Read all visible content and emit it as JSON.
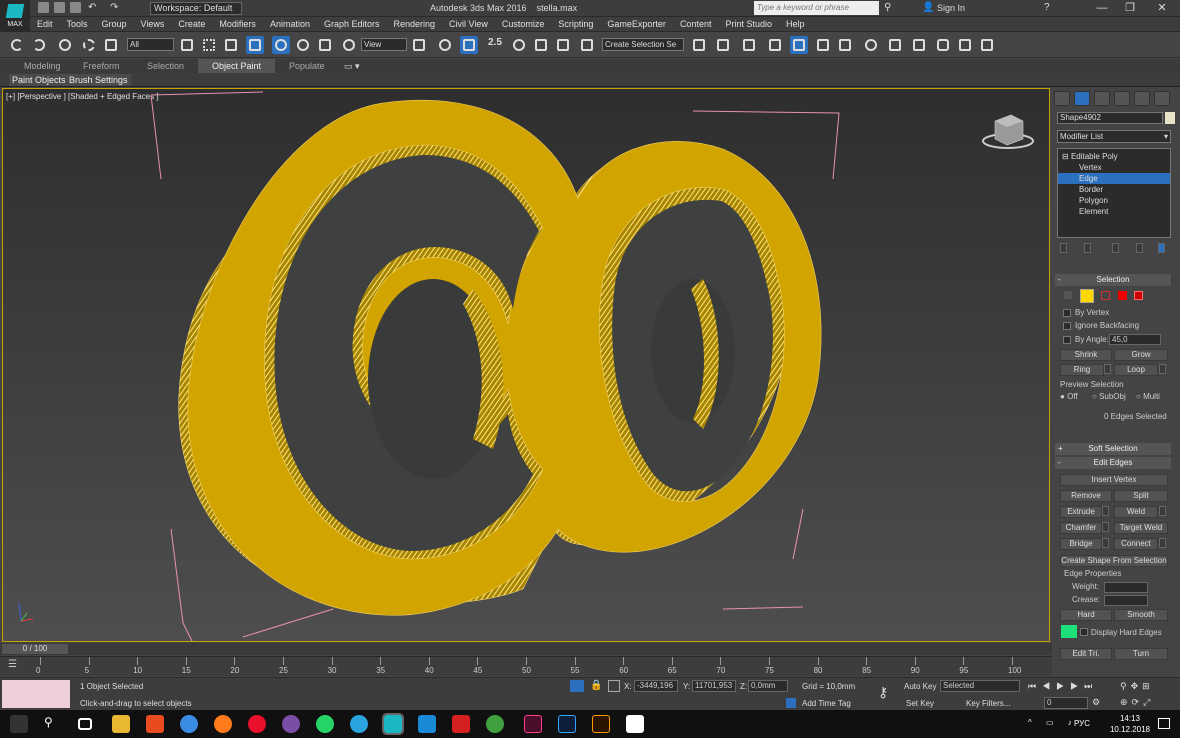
{
  "app": {
    "logo_text": "MAX",
    "title": "Autodesk 3ds Max 2016",
    "file": "stella.max",
    "workspace": "Workspace: Default",
    "search_placeholder": "Type a keyword or phrase",
    "sign_in": "Sign In"
  },
  "menu": [
    "Edit",
    "Tools",
    "Group",
    "Views",
    "Create",
    "Modifiers",
    "Animation",
    "Graph Editors",
    "Rendering",
    "Civil View",
    "Customize",
    "Scripting",
    "GameExporter",
    "Content",
    "Print Studio",
    "Help"
  ],
  "toolbar": {
    "filter_value": "All",
    "refcoord_value": "View",
    "selection_set_placeholder": "Create Selection Se",
    "snap_label": "2.5"
  },
  "ribbon": {
    "tabs": [
      "Modeling",
      "Freeform",
      "Selection",
      "Object Paint",
      "Populate"
    ],
    "active_tab": "Object Paint",
    "sub": [
      "Paint Objects",
      "Brush Settings"
    ]
  },
  "viewport": {
    "label": "[+] [Perspective ] [Shaded + Edged Faces ]",
    "object_color": "#d1a400"
  },
  "panel": {
    "object_name": "Shape4902",
    "modifier_list": "Modifier List",
    "stack": [
      {
        "label": "Editable Poly",
        "selected": false
      },
      {
        "label": "Vertex",
        "selected": false
      },
      {
        "label": "Edge",
        "selected": true
      },
      {
        "label": "Border",
        "selected": false
      },
      {
        "label": "Polygon",
        "selected": false
      },
      {
        "label": "Element",
        "selected": false
      }
    ],
    "selection": {
      "title": "Selection",
      "by_vertex": "By Vertex",
      "ignore_backfacing": "Ignore Backfacing",
      "by_angle": "By Angle:",
      "angle_value": "45,0",
      "shrink": "Shrink",
      "grow": "Grow",
      "ring": "Ring",
      "loop": "Loop",
      "preview_title": "Preview Selection",
      "preview_off": "Off",
      "preview_subobj": "SubObj",
      "preview_multi": "Multi",
      "count": "0 Edges Selected"
    },
    "soft_selection": "Soft Selection",
    "edit_edges": {
      "title": "Edit Edges",
      "insert_vertex": "Insert Vertex",
      "remove": "Remove",
      "split": "Split",
      "extrude": "Extrude",
      "weld": "Weld",
      "chamfer": "Chamfer",
      "target_weld": "Target Weld",
      "bridge": "Bridge",
      "connect": "Connect",
      "create_shape": "Create Shape From Selection",
      "edge_props": "Edge Properties",
      "weight": "Weight:",
      "crease": "Crease:",
      "hard": "Hard",
      "smooth": "Smooth",
      "display_hard": "Display Hard Edges",
      "edit_tri": "Edit Tri.",
      "turn": "Turn"
    }
  },
  "timeline": {
    "frame": "0 / 100",
    "ticks": [
      "0",
      "5",
      "10",
      "15",
      "20",
      "25",
      "30",
      "35",
      "40",
      "45",
      "50",
      "55",
      "60",
      "65",
      "70",
      "75",
      "80",
      "85",
      "90",
      "95",
      "100"
    ]
  },
  "status": {
    "selected": "1 Object Selected",
    "prompt": "Click-and-drag to select objects",
    "x_label": "X:",
    "x_value": "-3449,196",
    "y_label": "Y:",
    "y_value": "11701,953",
    "z_label": "Z:",
    "z_value": "0,0mm",
    "grid": "Grid = 10,0mm",
    "add_time_tag": "Add Time Tag",
    "auto_key": "Auto Key",
    "set_key": "Set Key",
    "key_mode": "Selected",
    "key_filters": "Key Filters...",
    "frame_field": "0"
  },
  "taskbar": {
    "lang": "РУС",
    "time": "14:13",
    "date": "10.12.2018"
  }
}
